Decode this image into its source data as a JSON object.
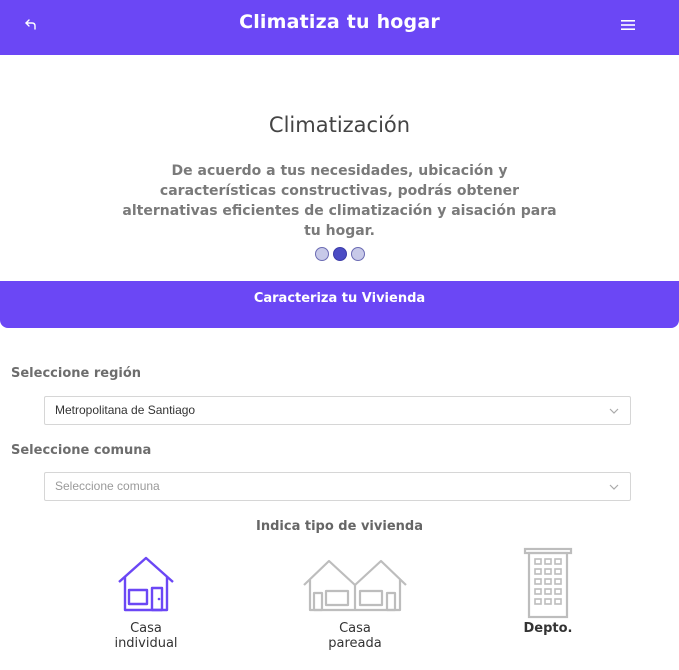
{
  "header": {
    "title": "Climatiza tu hogar",
    "back_icon": "back-arrow-icon",
    "menu_icon": "hamburger-menu-icon"
  },
  "hero": {
    "title": "Climatización",
    "text": "De acuerdo a tus necesidades, ubicación y características constructivas, podrás obtener alternativas eficientes de climatización y aisación para tu hogar.",
    "slides": 3,
    "active_slide": 2
  },
  "section": {
    "title": "Caracteriza tu Vivienda"
  },
  "form": {
    "region_label": "Seleccione región",
    "region_value": "Metropolitana de Santiago",
    "comuna_label": "Seleccione comuna",
    "comuna_placeholder": "Seleccione comuna"
  },
  "housing": {
    "title": "Indica tipo de vivienda",
    "options": [
      {
        "line1": "Casa",
        "line2": "individual",
        "selected": true
      },
      {
        "line1": "Casa",
        "line2": "pareada",
        "selected": false
      },
      {
        "line1": "Depto.",
        "line2": "",
        "selected": false
      }
    ]
  },
  "colors": {
    "accent": "#6b47f5",
    "dot_active": "#4b4cc4",
    "dot_inactive": "#c7c9e8",
    "icon_inactive": "#bdbdbd"
  }
}
